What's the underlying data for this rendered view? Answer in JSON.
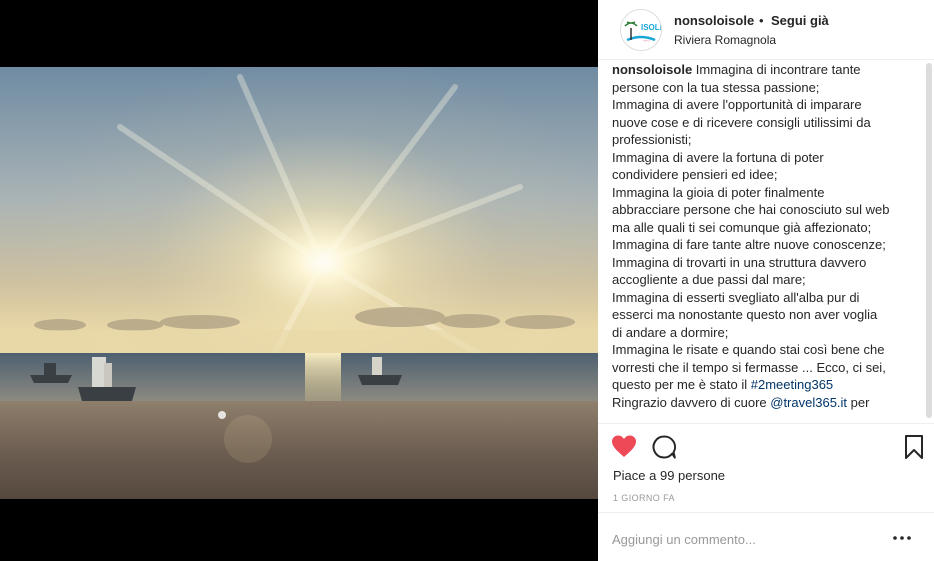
{
  "post": {
    "username": "nonsoloisole",
    "separator": "•",
    "follow_label": "Segui già",
    "location": "Riviera Romagnola",
    "caption_lines": [
      {
        "user": "nonsoloisole",
        "text": " Immagina di incontrare tante"
      },
      {
        "text": "persone con la tua stessa passione;"
      },
      {
        "text": "Immagina di avere l'opportunità di imparare"
      },
      {
        "text": "nuove cose e di ricevere consigli utilissimi da"
      },
      {
        "text": "professionisti;"
      },
      {
        "text": "Immagina di avere la fortuna di poter"
      },
      {
        "text": "condividere pensieri ed idee;"
      },
      {
        "text": "Immagina la gioia di poter finalmente"
      },
      {
        "text": "abbracciare persone che hai conosciuto sul web"
      },
      {
        "text": "ma alle quali ti sei comunque già affezionato;"
      },
      {
        "text": "Immagina di fare tante altre nuove conoscenze;"
      },
      {
        "text": "Immagina di trovarti in una struttura davvero"
      },
      {
        "text": "accogliente a due passi dal mare;"
      },
      {
        "text": "Immagina di esserti svegliato all'alba pur di"
      },
      {
        "text": "esserci ma nonostante questo non aver voglia"
      },
      {
        "text": "di andare a dormire;"
      },
      {
        "text": "Immagina le risate e quando stai così bene che"
      },
      {
        "text": "vorresti che il tempo si fermasse ... Ecco, ci sei,"
      },
      {
        "text": "questo per me è stato il ",
        "link": "#2meeting365"
      },
      {
        "text": "Ringrazio davvero di cuore ",
        "link": "@travel365.it",
        "after": " per"
      }
    ],
    "likes_text": "Piace a 99 persone",
    "timestamp": "1 GIORNO FA",
    "comment_placeholder": "Aggiungi un commento...",
    "liked": true
  },
  "icons": {
    "like": "heart-icon",
    "comment": "comment-bubble-icon",
    "save": "bookmark-icon",
    "more": "more-options-icon"
  },
  "colors": {
    "heart": "#ed4956",
    "link": "#003569",
    "muted": "#999999",
    "border": "#efefef"
  }
}
